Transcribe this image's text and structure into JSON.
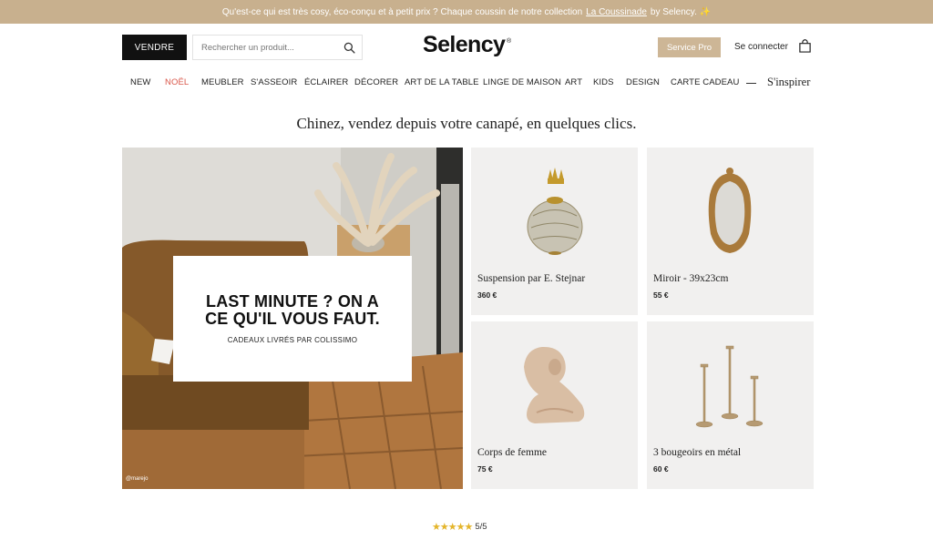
{
  "promo": {
    "text_before": "Qu'est-ce qui est très cosy, éco-conçu et à petit prix ? Chaque coussin de notre collection",
    "link_text": "La Coussinade",
    "text_after": "by Selency. ✨"
  },
  "header": {
    "sell_label": "VENDRE",
    "search_placeholder": "Rechercher un produit...",
    "logo_text": "Selency",
    "logo_mark": "®",
    "pro_label": "Service Pro",
    "login_label": "Se connecter"
  },
  "nav": {
    "items": [
      "NEW",
      "NOËL",
      "MEUBLER",
      "S'ASSEOIR",
      "ÉCLAIRER",
      "DÉCORER",
      "ART DE LA TABLE",
      "LINGE DE MAISON",
      "ART",
      "KIDS",
      "DESIGN",
      "CARTE CADEAU"
    ],
    "inspire_label": "S'inspirer",
    "accent_color": "#d9574a"
  },
  "tagline": "Chinez, vendez depuis votre canapé, en quelques clics.",
  "hero": {
    "title": "LAST MINUTE ? ON A CE QU'IL VOUS FAUT.",
    "subtitle": "CADEAUX LIVRÉS PAR COLISSIMO",
    "credit": "@marejo"
  },
  "products": [
    {
      "name": "Suspension par E. Stejnar",
      "price": "360 €"
    },
    {
      "name": "Miroir - 39x23cm",
      "price": "55 €"
    },
    {
      "name": "Corps de femme",
      "price": "75 €"
    },
    {
      "name": "3 bougeoirs en métal",
      "price": "60 €"
    }
  ],
  "rating": {
    "stars": "★★★★★",
    "score_text": "5/5",
    "star_color": "#e4b52b"
  },
  "colors": {
    "promo_bg": "#c8b08e",
    "pro_button_bg": "#cdb696",
    "sell_button_bg": "#111111",
    "product_card_bg": "#f1f0ef"
  }
}
